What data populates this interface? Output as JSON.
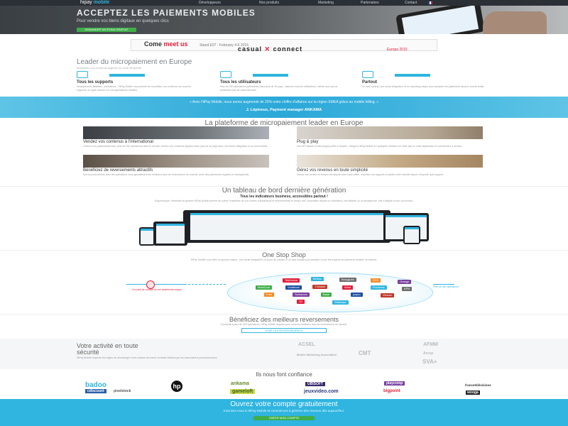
{
  "nav": {
    "logo_a": "hipay",
    "logo_b": "mobile",
    "items": [
      "Développeurs",
      "Nos produits",
      "Marketing",
      "Partenaires",
      "Contact"
    ],
    "flag": "fr-flag-icon"
  },
  "hero": {
    "title": "ACCEPTEZ LES PAIEMENTS MOBILES",
    "subtitle": "Pour vendre vos biens digitaux en quelques clics",
    "cta": "DEMANDER UN ESSAI GRATUIT"
  },
  "banner": {
    "come": "Come",
    "meet": "meet us",
    "stand": "Stand E07 · February 4-6 2015",
    "casual": "casual",
    "connect": "connect",
    "region": "Europe 2015"
  },
  "leader": {
    "title": "Leader du micropaiement en Europe",
    "subtitle": "Monétisez vos contenus digitaux en toute simplicité",
    "features": [
      {
        "label": "Tous les supports",
        "desc": "Smartphones, tablettes, ordinateurs : HiPay Mobile vous permet de monétiser vos contenus sur tous les supports, en ligne comme sur vos applications mobiles."
      },
      {
        "label": "Tous les utilisateurs",
        "desc": "Plus de 300 opérateurs partenaires dans plus de 40 pays : facturez tous les utilisateurs, même ceux qui ne possèdent pas de carte bancaire."
      },
      {
        "label": "Partout",
        "desc": "Un seul contrat, une seule intégration et un reporting unique pour accepter les paiements dans le monde entier."
      }
    ]
  },
  "quote": {
    "text": "« Avec HiPay Mobile, nous avons augmenté de 20% notre chiffre d'affaires sur la région EMEA grâce au mobile billing. »",
    "author": "J. Lépineux, Payment manager ANKAMA"
  },
  "platform": {
    "title": "La plateforme de micropaiement leader en Europe",
    "tiles": [
      {
        "title": "Vendez vos contenus à l'international",
        "text": "Grâce à nos partenariats avec plus de 300 opérateurs dans le monde, vendez vos contenus digitaux dans plus de 40 pays avec une seule intégration et un seul contrat."
      },
      {
        "title": "Plug & play",
        "text": "Une API simple et des plugins prêts à l'emploi : intégrez HiPay Mobile en quelques minutes sur votre site ou votre application et commencez à vendre."
      },
      {
        "title": "Bénéficiez de reversements attractifs",
        "text": "Nos accords directs avec les opérateurs vous garantissent les meilleurs taux de reversement du marché, avec des paiements réguliers et transparents."
      },
      {
        "title": "Gérez vos revenus en toute simplicité",
        "text": "Suivez vos ventes en temps réel depuis votre back-office, exportez vos rapports et pilotez votre activité depuis n'importe quel support."
      }
    ]
  },
  "dashboard": {
    "title": "Un tableau de bord dernière génération",
    "subtitle": "Tous les indicateurs business, accessibles partout !",
    "text": "Ergonomique, l'interface de gestion HiPay Mobile permet de suivre l'ensemble de vos ventes, transactions et reversements en temps réel. Accessible depuis un ordinateur, une tablette ou un smartphone, elle s'adapte à tous vos écrans."
  },
  "onestop": {
    "title": "One Stop Shop",
    "text": "HiPay Mobile vous offre un guichet unique : une seule intégration, un point de contact et un seul contrat pour accéder à tous les moyens de paiement mobiles du marché.",
    "left_label": "Un point de contact et une plateforme unique",
    "right_label": "Plus de 300 opérateurs",
    "logos": [
      "Telefónica",
      "Belfius",
      "Bouygues",
      "SFR",
      "Orange",
      "MobiCom",
      "Vodafone",
      "T-Mobile",
      "Wind",
      "Proximus",
      "KPN",
      "Free",
      "Swisscom",
      "Base",
      "payco",
      "Verizon",
      "O2",
      "Wataniya"
    ]
  },
  "reversements": {
    "title": "Bénéficiez des meilleurs reversements",
    "text": "Connecté à plus de 300 opérateurs, HiPay Mobile négocie pour vous les meilleurs taux de reversement du marché.",
    "cta": "VOIR LES REVERSEMENTS"
  },
  "security": {
    "title": "Votre activité en toute sécurité",
    "text": "HiPay Mobile respecte les règles de déontologie et les chartes de bonne conduite établies par les associations professionnelles.",
    "logos": [
      "ACSEL",
      "AFMM",
      "Mobile Marketing Association",
      "CMT",
      "Arcep",
      "SVA+"
    ]
  },
  "trust": {
    "title": "Ils nous font confiance",
    "logos": [
      "badoo",
      "hp",
      "ankama",
      "UBISOFT",
      "playcomp",
      "cdiscount",
      "gameloft",
      "bigpoint",
      "francetélévisions",
      "pixelstock",
      "jeuxvideo.com",
      "wooga"
    ]
  },
  "signup": {
    "title": "Ouvrez votre compte gratuitement",
    "text": "Inscrivez-vous à HiPay Mobile et commencez à générer des revenus dès aujourd'hui.",
    "cta": "CRÉER MON COMPTE"
  },
  "colors": {
    "accent": "#2fb5e0",
    "cta_green": "#3fae4a",
    "dark_nav": "#2b2f36",
    "red": "#e31d3a"
  }
}
